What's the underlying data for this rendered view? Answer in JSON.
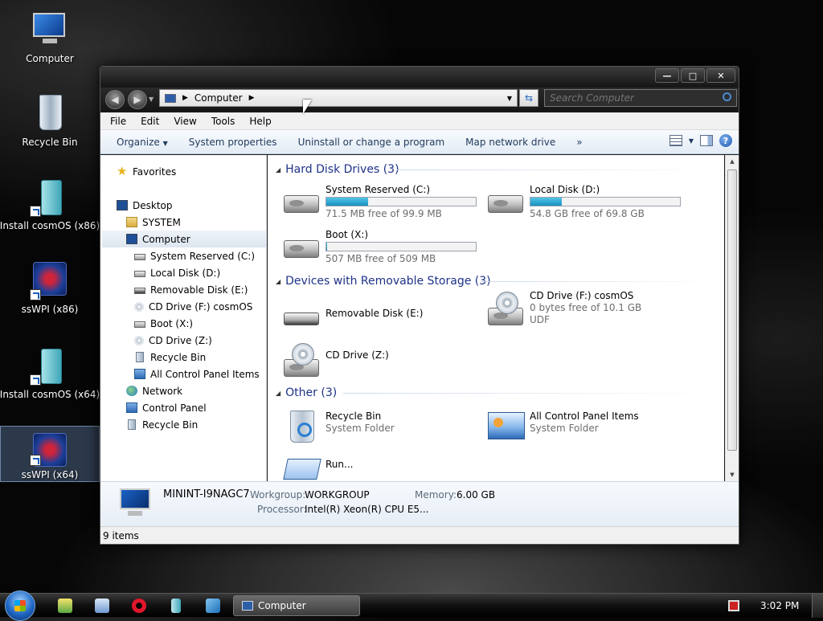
{
  "desktop": {
    "icons": [
      {
        "label": "Computer",
        "icon": "computer-icon"
      },
      {
        "label": "Recycle Bin",
        "icon": "recycle-bin-icon"
      },
      {
        "label": "Install cosmOS (x86)",
        "icon": "installer-icon"
      },
      {
        "label": "ssWPI (x86)",
        "icon": "sswpi-icon"
      },
      {
        "label": "Install cosmOS (x64)",
        "icon": "installer-icon"
      },
      {
        "label": "ssWPI (x64)",
        "icon": "sswpi-icon"
      }
    ]
  },
  "window": {
    "address": {
      "crumb": "Computer"
    },
    "search": {
      "placeholder": "Search Computer"
    },
    "menu": [
      "File",
      "Edit",
      "View",
      "Tools",
      "Help"
    ],
    "commands": [
      "Organize",
      "System properties",
      "Uninstall or change a program",
      "Map network drive",
      "»"
    ],
    "nav": {
      "favorites": "Favorites",
      "desktop": "Desktop",
      "system": "SYSTEM",
      "computer": "Computer",
      "children": [
        "System Reserved (C:)",
        "Local Disk (D:)",
        "Removable Disk (E:)",
        "CD Drive (F:) cosmOS",
        "Boot (X:)",
        "CD Drive (Z:)",
        "Recycle Bin",
        "All Control Panel Items"
      ],
      "network": "Network",
      "control_panel": "Control Panel",
      "recycle_bin": "Recycle Bin"
    },
    "groups": {
      "hdd": {
        "title": "Hard Disk Drives (3)",
        "items": [
          {
            "name": "System Reserved (C:)",
            "free": "71.5 MB free of 99.9 MB",
            "used_fraction": 0.28
          },
          {
            "name": "Local Disk (D:)",
            "free": "54.8 GB free of 69.8 GB",
            "used_fraction": 0.21
          },
          {
            "name": "Boot (X:)",
            "free": "507 MB free of 509 MB",
            "used_fraction": 0.004
          }
        ]
      },
      "removable": {
        "title": "Devices with Removable Storage (3)",
        "items": [
          {
            "name": "Removable Disk (E:)"
          },
          {
            "name": "CD Drive (F:) cosmOS",
            "free": "0 bytes free of 10.1 GB",
            "fs": "UDF"
          },
          {
            "name": "CD Drive (Z:)"
          }
        ]
      },
      "other": {
        "title": "Other (3)",
        "items": [
          {
            "name": "Recycle Bin",
            "type": "System Folder"
          },
          {
            "name": "All Control Panel Items",
            "type": "System Folder"
          },
          {
            "name": "Run..."
          }
        ]
      }
    },
    "details": {
      "computer_name": "MININT-I9NAGC7",
      "workgroup_label": "Workgroup:",
      "workgroup": "WORKGROUP",
      "memory_label": "Memory:",
      "memory": "6.00 GB",
      "processor_label": "Processor:",
      "processor": "Intel(R) Xeon(R) CPU E5..."
    },
    "status": "9 items"
  },
  "taskbar": {
    "task_label": "Computer",
    "clock": "3:02 PM"
  }
}
